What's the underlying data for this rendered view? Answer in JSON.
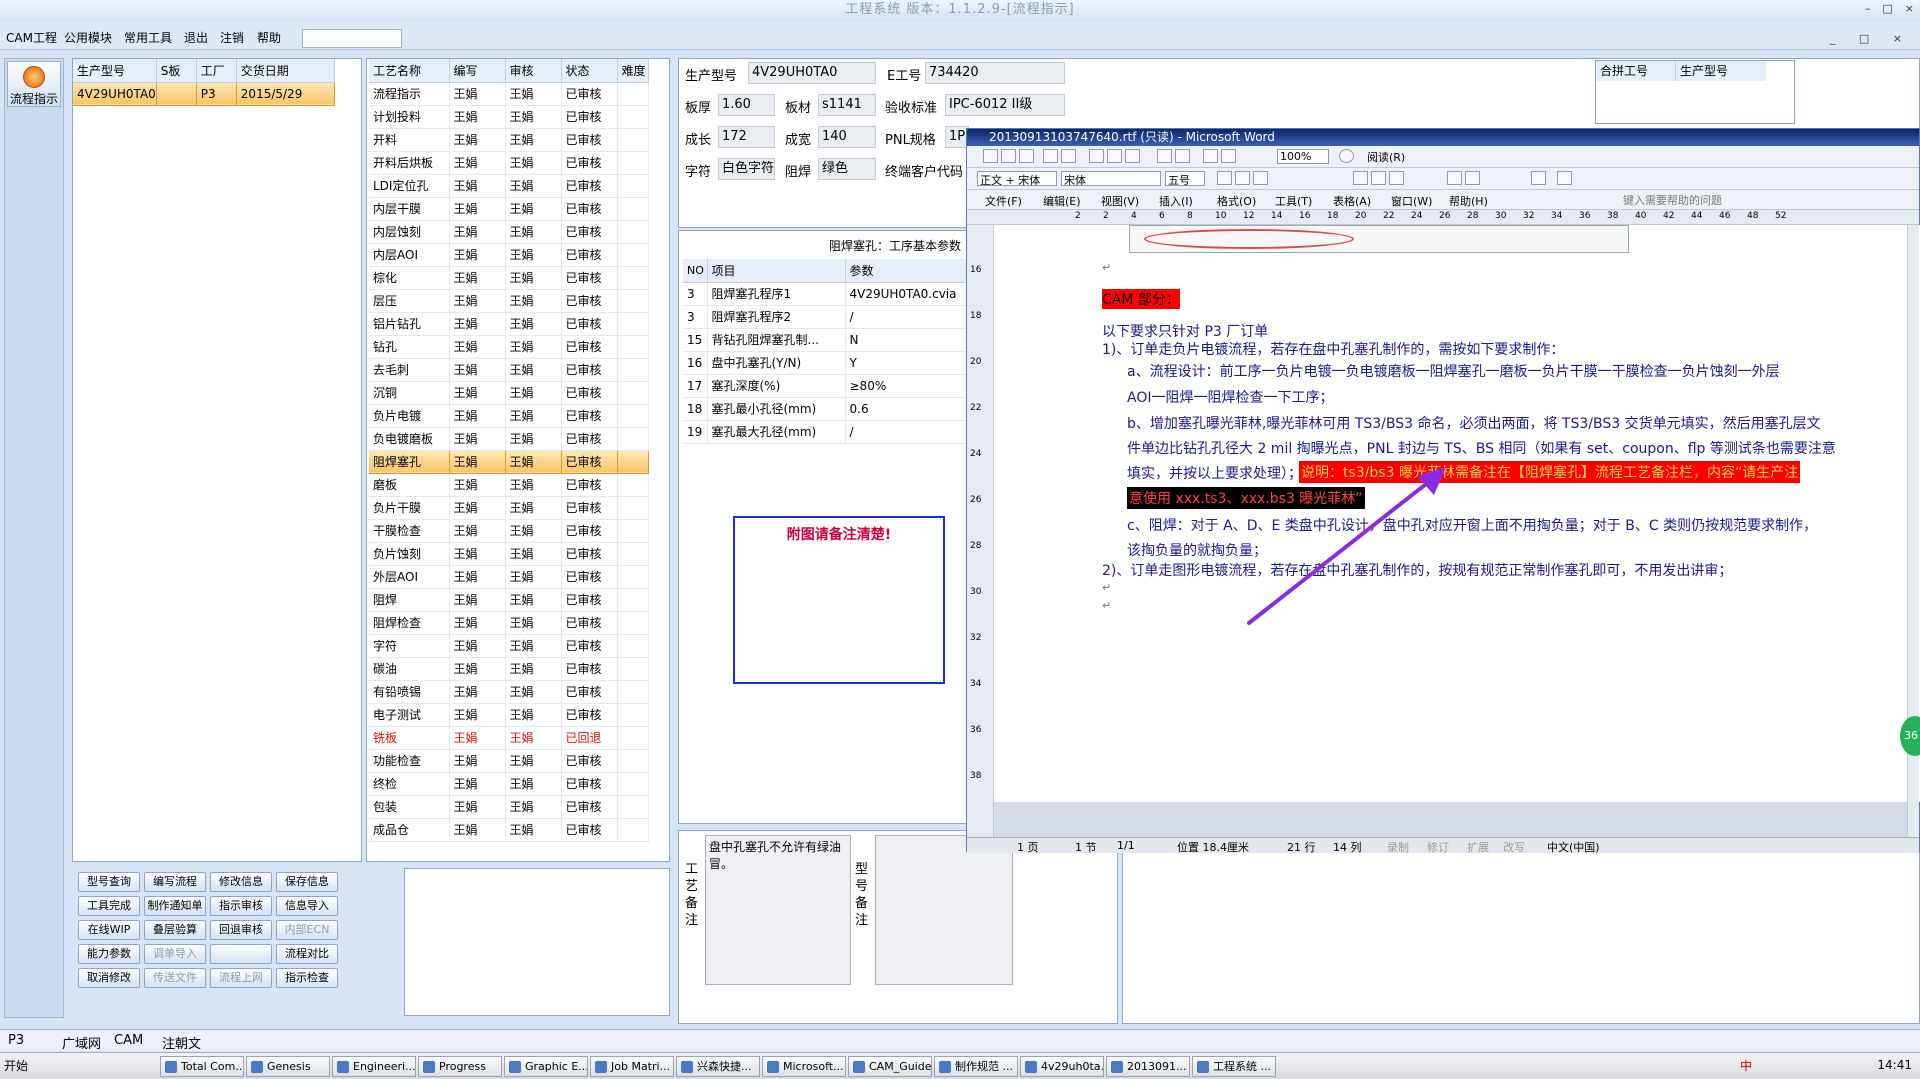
{
  "window": {
    "title": "工程系统 版本：1.1.2.9-[流程指示]",
    "controls": [
      "–",
      "□",
      "×"
    ]
  },
  "menu": [
    "CAM工程",
    "公用模块",
    "常用工具",
    "退出",
    "注销",
    "帮助"
  ],
  "menu_ctl": "_ □ ×",
  "nav": {
    "button": "流程指示"
  },
  "model_table": {
    "headers": [
      "生产型号",
      "S板",
      "工厂",
      "交货日期"
    ],
    "rows": [
      [
        "4V29UH0TA0",
        "",
        "P3",
        "2015/5/29"
      ]
    ]
  },
  "process_table": {
    "headers": [
      "工艺名称",
      "编写",
      "审核",
      "状态",
      "难度"
    ],
    "rows": [
      [
        "流程指示",
        "王娟",
        "王娟",
        "已审核"
      ],
      [
        "计划投料",
        "王娟",
        "王娟",
        "已审核"
      ],
      [
        "开料",
        "王娟",
        "王娟",
        "已审核"
      ],
      [
        "开料后烘板",
        "王娟",
        "王娟",
        "已审核"
      ],
      [
        "LDI定位孔",
        "王娟",
        "王娟",
        "已审核"
      ],
      [
        "内层干膜",
        "王娟",
        "王娟",
        "已审核"
      ],
      [
        "内层蚀刻",
        "王娟",
        "王娟",
        "已审核"
      ],
      [
        "内层AOI",
        "王娟",
        "王娟",
        "已审核"
      ],
      [
        "棕化",
        "王娟",
        "王娟",
        "已审核"
      ],
      [
        "层压",
        "王娟",
        "王娟",
        "已审核"
      ],
      [
        "铝片钻孔",
        "王娟",
        "王娟",
        "已审核"
      ],
      [
        "钻孔",
        "王娟",
        "王娟",
        "已审核"
      ],
      [
        "去毛刺",
        "王娟",
        "王娟",
        "已审核"
      ],
      [
        "沉铜",
        "王娟",
        "王娟",
        "已审核"
      ],
      [
        "负片电镀",
        "王娟",
        "王娟",
        "已审核"
      ],
      [
        "负电镀磨板",
        "王娟",
        "王娟",
        "已审核"
      ],
      [
        "阻焊塞孔",
        "王娟",
        "王娟",
        "已审核"
      ],
      [
        "磨板",
        "王娟",
        "王娟",
        "已审核"
      ],
      [
        "负片干膜",
        "王娟",
        "王娟",
        "已审核"
      ],
      [
        "干膜检查",
        "王娟",
        "王娟",
        "已审核"
      ],
      [
        "负片蚀刻",
        "王娟",
        "王娟",
        "已审核"
      ],
      [
        "外层AOI",
        "王娟",
        "王娟",
        "已审核"
      ],
      [
        "阻焊",
        "王娟",
        "王娟",
        "已审核"
      ],
      [
        "阻焊检查",
        "王娟",
        "王娟",
        "已审核"
      ],
      [
        "字符",
        "王娟",
        "王娟",
        "已审核"
      ],
      [
        "碳油",
        "王娟",
        "王娟",
        "已审核"
      ],
      [
        "有铅喷锡",
        "王娟",
        "王娟",
        "已审核"
      ],
      [
        "电子测试",
        "王娟",
        "王娟",
        "已审核"
      ],
      [
        "铣板",
        "王娟",
        "王娟",
        "已回退"
      ],
      [
        "功能检查",
        "王娟",
        "王娟",
        "已审核"
      ],
      [
        "终检",
        "王娟",
        "王娟",
        "已审核"
      ],
      [
        "包装",
        "王娟",
        "王娟",
        "已审核"
      ],
      [
        "成品仓",
        "王娟",
        "王娟",
        "已审核"
      ]
    ]
  },
  "buttons": [
    [
      "型号查询",
      "编写流程",
      "修改信息",
      "保存信息"
    ],
    [
      "工具完成",
      "制作通知单",
      "指示审核",
      "信息导入"
    ],
    [
      "在线WIP",
      "叠层验算",
      "回退审核",
      "内部ECN"
    ],
    [
      "能力参数",
      "调单导入",
      "",
      "流程对比"
    ],
    [
      "取消修改",
      "传送文件",
      "流程上网",
      "指示检查"
    ]
  ],
  "info": {
    "prod_model_lbl": "生产型号",
    "prod_model": "4V29UH0TA0",
    "eno_lbl": "E工号",
    "eno": "734420",
    "thick_lbl": "板厚",
    "thick": "1.60",
    "mat_lbl": "板材",
    "mat": "s1141",
    "std_lbl": "验收标准",
    "std": "IPC-6012 II级",
    "len_lbl": "成长",
    "len": "172",
    "wid_lbl": "成宽",
    "wid": "140",
    "pnl_lbl": "PNL规格",
    "pnl": "1P",
    "char_lbl": "字符",
    "char": "白色字符",
    "mask_lbl": "阻焊",
    "mask": "绿色",
    "cust_lbl": "终端客户代码"
  },
  "merge_table": {
    "headers": [
      "合拼工号",
      "生产型号"
    ]
  },
  "params": {
    "title": "阻焊塞孔：工序基本参数",
    "headers": [
      "NO",
      "项目",
      "参数"
    ],
    "rows": [
      [
        "3",
        "阻焊塞孔程序1",
        "4V29UH0TA0.cvia"
      ],
      [
        "3",
        "阻焊塞孔程序2",
        "/"
      ],
      [
        "15",
        "背钻孔阻焊塞孔制...",
        "N"
      ],
      [
        "16",
        "盘中孔塞孔(Y/N)",
        "Y"
      ],
      [
        "17",
        "塞孔深度(%)",
        "≥80%"
      ],
      [
        "18",
        "塞孔最小孔径(mm)",
        "0.6"
      ],
      [
        "19",
        "塞孔最大孔径(mm)",
        "/"
      ]
    ]
  },
  "notice": "附图请备注清楚!",
  "remarks": {
    "process_label": "工艺备注",
    "process_text": "盘中孔塞孔不允许有绿油冒。",
    "model_label": "型号备注"
  },
  "word": {
    "title": "20130913103747640.rtf (只读) - Microsoft Word",
    "font_style": "正文 + 宋体",
    "font": "宋体",
    "size": "五号",
    "zoom": "100%",
    "read_btn": "阅读(R)",
    "menu": [
      "文件(F)",
      "编辑(E)",
      "视图(V)",
      "插入(I)",
      "格式(O)",
      "工具(T)",
      "表格(A)",
      "窗口(W)",
      "帮助(H)"
    ],
    "help_box": "键入需要帮助的问题",
    "ruler": [
      "2",
      "2",
      "4",
      "6",
      "8",
      "10",
      "12",
      "14",
      "16",
      "18",
      "20",
      "22",
      "24",
      "26",
      "28",
      "30",
      "32",
      "34",
      "36",
      "38",
      "40",
      "42",
      "44",
      "46",
      "48",
      "52"
    ],
    "vruler": [
      "16",
      "18",
      "20",
      "22",
      "24",
      "26",
      "28",
      "30",
      "32",
      "34",
      "36",
      "38"
    ],
    "doc": {
      "cam": "CAM 部分：",
      "intro": "以下要求只针对 P3 厂订单",
      "p1": "1)、订单走负片电镀流程，若存在盘中孔塞孔制作的，需按如下要求制作：",
      "a1": "a、流程设计：前工序一负片电镀一负电镀磨板一阻焊塞孔一磨板一负片干膜一干膜检查一负片蚀刻一外层",
      "a2": "AOI一阻焊一阻焊检查一下工序；",
      "b1": "b、增加塞孔曝光菲林,曝光菲林可用 TS3/BS3 命名，必须出两面，将 TS3/BS3 交货单元填实，然后用塞孔层文",
      "b2": "件单边比钻孔孔径大 2 mil 掏曝光点，PNL 封边与 TS、BS 相同（如果有 set、coupon、flp 等测试条也需要注意",
      "b3": "填实，并按以上要求处理）；",
      "b3r": "说明：ts3/bs3 曝光菲林需备注在【阻焊塞孔】流程工艺备注栏，内容“请生产注",
      "b4": "意使用 xxx.ts3、xxx.bs3 曝光菲林”",
      "c1": "c、阻焊：对于 A、D、E 类盘中孔设计，盘中孔对应开窗上面不用掏负量；对于 B、C 类则仍按规范要求制作，",
      "c2": "该掏负量的就掏负量；",
      "p2": "2)、订单走图形电镀流程，若存在盘中孔塞孔制作的，按规有规范正常制作塞孔即可，不用发出讲审；"
    },
    "status": [
      "1 页",
      "1 节",
      "1/1",
      "位置 18.4厘米",
      "21 行",
      "14 列",
      "录制",
      "修订",
      "扩展",
      "改写",
      "中文(中国)"
    ],
    "side_badge": "36"
  },
  "bottom_tabs": {
    "factory": "P3",
    "tabs": [
      "广域网",
      "CAM",
      "注朝文"
    ]
  },
  "taskbar": {
    "start": "开始",
    "tasks": [
      "Total Com...",
      "Genesis",
      "Engineeri...",
      "Progress",
      "Graphic E...",
      "Job Matri...",
      "兴森快捷...",
      "Microsoft...",
      "CAM_Guide...",
      "制作规范 ...",
      "4v29uh0ta...",
      "2013091...",
      "工程系统 ..."
    ],
    "time": "14:41",
    "ime": "中"
  },
  "colors": {
    "accent": "#f8c56a",
    "reject": "#e01010",
    "notice": "#d0003a",
    "arrow": "#8a2be2",
    "highlight_red": "#ff0000",
    "highlight_yellow": "#ffff00"
  }
}
